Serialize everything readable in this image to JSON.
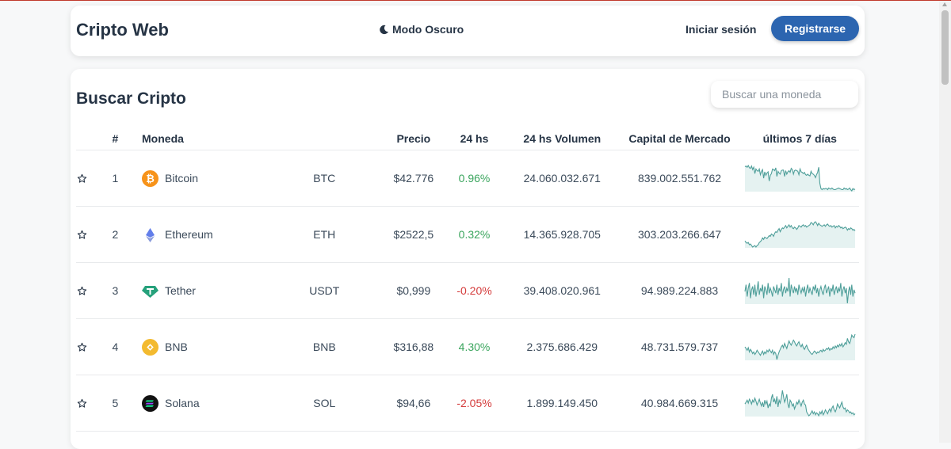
{
  "navbar": {
    "brand": "Cripto Web",
    "dark_mode_label": "Modo Oscuro",
    "login_label": "Iniciar sesión",
    "register_label": "Registrarse"
  },
  "market": {
    "title": "Buscar Cripto",
    "search_placeholder": "Buscar una moneda",
    "columns": [
      "#",
      "Moneda",
      "",
      "Precio",
      "24 hs",
      "24 hs Volumen",
      "Capital de Mercado",
      "últimos 7 días"
    ],
    "rows": [
      {
        "rank": "1",
        "name": "Bitcoin",
        "symbol": "BTC",
        "price": "$42.776",
        "change": "0.96%",
        "volume": "24.060.032.671",
        "market_cap": "839.002.551.762",
        "icon": "bitcoin-icon",
        "color": "#f7931a",
        "spark": [
          42,
          43,
          41,
          44,
          40,
          39,
          43,
          37,
          41,
          30,
          38,
          35,
          34,
          38,
          28,
          34,
          37,
          22,
          33,
          27,
          31,
          33,
          17,
          27,
          30,
          38,
          37,
          35,
          40,
          25,
          34,
          31,
          29,
          35,
          36,
          36,
          25,
          35,
          29,
          33,
          35,
          32,
          39,
          37,
          29,
          35,
          36,
          35,
          34,
          28,
          38,
          33,
          32,
          30,
          32,
          28,
          27,
          29,
          27,
          26,
          34,
          30,
          29,
          27,
          23,
          28,
          32,
          41,
          13,
          4,
          2,
          4,
          3,
          4,
          4,
          2,
          5,
          4,
          3,
          5,
          3,
          2,
          2,
          3,
          4,
          5,
          4,
          3,
          2,
          2,
          5,
          3,
          4,
          2,
          3,
          5,
          2,
          0,
          4,
          2,
          3
        ]
      },
      {
        "rank": "2",
        "name": "Ethereum",
        "symbol": "ETH",
        "price": "$2522,5",
        "change": "0.32%",
        "volume": "14.365.928.705",
        "market_cap": "303.203.266.647",
        "icon": "ethereum-icon",
        "color": "#627eea",
        "spark": [
          10,
          8,
          7,
          8,
          5,
          6,
          4,
          2,
          3,
          4,
          2,
          4,
          5,
          8,
          9,
          11,
          14,
          12,
          15,
          14,
          13,
          15,
          17,
          16,
          19,
          18,
          16,
          20,
          22,
          21,
          24,
          26,
          22,
          25,
          27,
          26,
          28,
          30,
          27,
          29,
          31,
          28,
          30,
          27,
          26,
          28,
          27,
          25,
          27,
          30,
          29,
          28,
          30,
          31,
          29,
          30,
          28,
          29,
          30,
          31,
          34,
          33,
          31,
          34,
          35,
          33,
          30,
          33,
          31,
          30,
          29,
          30,
          31,
          29,
          31,
          32,
          30,
          29,
          30,
          28,
          29,
          30,
          27,
          29,
          28,
          30,
          29,
          27,
          28,
          26,
          27,
          28,
          27,
          24,
          26,
          25,
          27,
          26,
          24,
          25,
          23
        ]
      },
      {
        "rank": "3",
        "name": "Tether",
        "symbol": "USDT",
        "price": "$0,999",
        "change": "-0.20%",
        "volume": "39.408.020.961",
        "market_cap": "94.989.224.883",
        "icon": "tether-icon",
        "color": "#26a17b",
        "spark": [
          18,
          26,
          12,
          22,
          28,
          10,
          20,
          24,
          14,
          26,
          12,
          20,
          30,
          14,
          22,
          18,
          26,
          10,
          24,
          20,
          14,
          28,
          16,
          22,
          18,
          12,
          24,
          20,
          16,
          26,
          14,
          22,
          18,
          28,
          12,
          20,
          24,
          16,
          22,
          18,
          34,
          12,
          26,
          20,
          16,
          24,
          18,
          22,
          14,
          26,
          20,
          16,
          22,
          18,
          24,
          12,
          20,
          26,
          16,
          22,
          18,
          14,
          24,
          20,
          26,
          16,
          22,
          12,
          20,
          24,
          18,
          14,
          22,
          26,
          16,
          20,
          24,
          12,
          22,
          18,
          26,
          14,
          20,
          24,
          16,
          22,
          18,
          28,
          12,
          20,
          24,
          16,
          22,
          4,
          18,
          24,
          14,
          26,
          12,
          20,
          16
        ]
      },
      {
        "rank": "4",
        "name": "BNB",
        "symbol": "BNB",
        "price": "$316,88",
        "change": "4.30%",
        "volume": "2.375.686.429",
        "market_cap": "48.731.579.737",
        "icon": "bnb-icon",
        "color": "#f3ba2f",
        "spark": [
          18,
          16,
          14,
          17,
          12,
          15,
          13,
          10,
          12,
          9,
          11,
          14,
          12,
          10,
          8,
          11,
          13,
          9,
          12,
          10,
          14,
          12,
          15,
          13,
          11,
          14,
          9,
          12,
          10,
          3,
          8,
          12,
          15,
          18,
          20,
          17,
          22,
          19,
          16,
          21,
          25,
          22,
          20,
          23,
          26,
          24,
          21,
          19,
          22,
          24,
          20,
          18,
          21,
          17,
          15,
          18,
          20,
          16,
          14,
          12,
          10,
          9,
          11,
          13,
          12,
          10,
          12,
          11,
          13,
          14,
          12,
          15,
          13,
          14,
          16,
          15,
          17,
          14,
          16,
          15,
          18,
          16,
          19,
          17,
          20,
          18,
          21,
          19,
          22,
          18,
          20,
          23,
          21,
          28,
          24,
          22,
          26,
          32,
          30,
          29,
          33
        ]
      },
      {
        "rank": "5",
        "name": "Solana",
        "symbol": "SOL",
        "price": "$94,66",
        "change": "-2.05%",
        "volume": "1.899.149.450",
        "market_cap": "40.984.669.315",
        "icon": "solana-icon",
        "color": "#14f195",
        "spark": [
          20,
          22,
          24,
          21,
          25,
          23,
          20,
          24,
          22,
          26,
          23,
          19,
          22,
          25,
          21,
          18,
          22,
          17,
          24,
          20,
          23,
          16,
          20,
          18,
          26,
          30,
          22,
          25,
          20,
          28,
          17,
          24,
          21,
          26,
          34,
          28,
          22,
          25,
          30,
          20,
          16,
          24,
          22,
          18,
          20,
          15,
          18,
          22,
          20,
          24,
          21,
          18,
          22,
          24,
          20,
          19,
          12,
          10,
          8,
          9,
          11,
          13,
          10,
          12,
          9,
          11,
          10,
          8,
          12,
          10,
          13,
          9,
          11,
          14,
          12,
          10,
          13,
          15,
          12,
          16,
          18,
          14,
          12,
          15,
          20,
          18,
          16,
          19,
          22,
          17,
          15,
          16,
          12,
          14,
          13,
          11,
          12,
          10,
          11,
          9,
          10
        ]
      }
    ]
  }
}
